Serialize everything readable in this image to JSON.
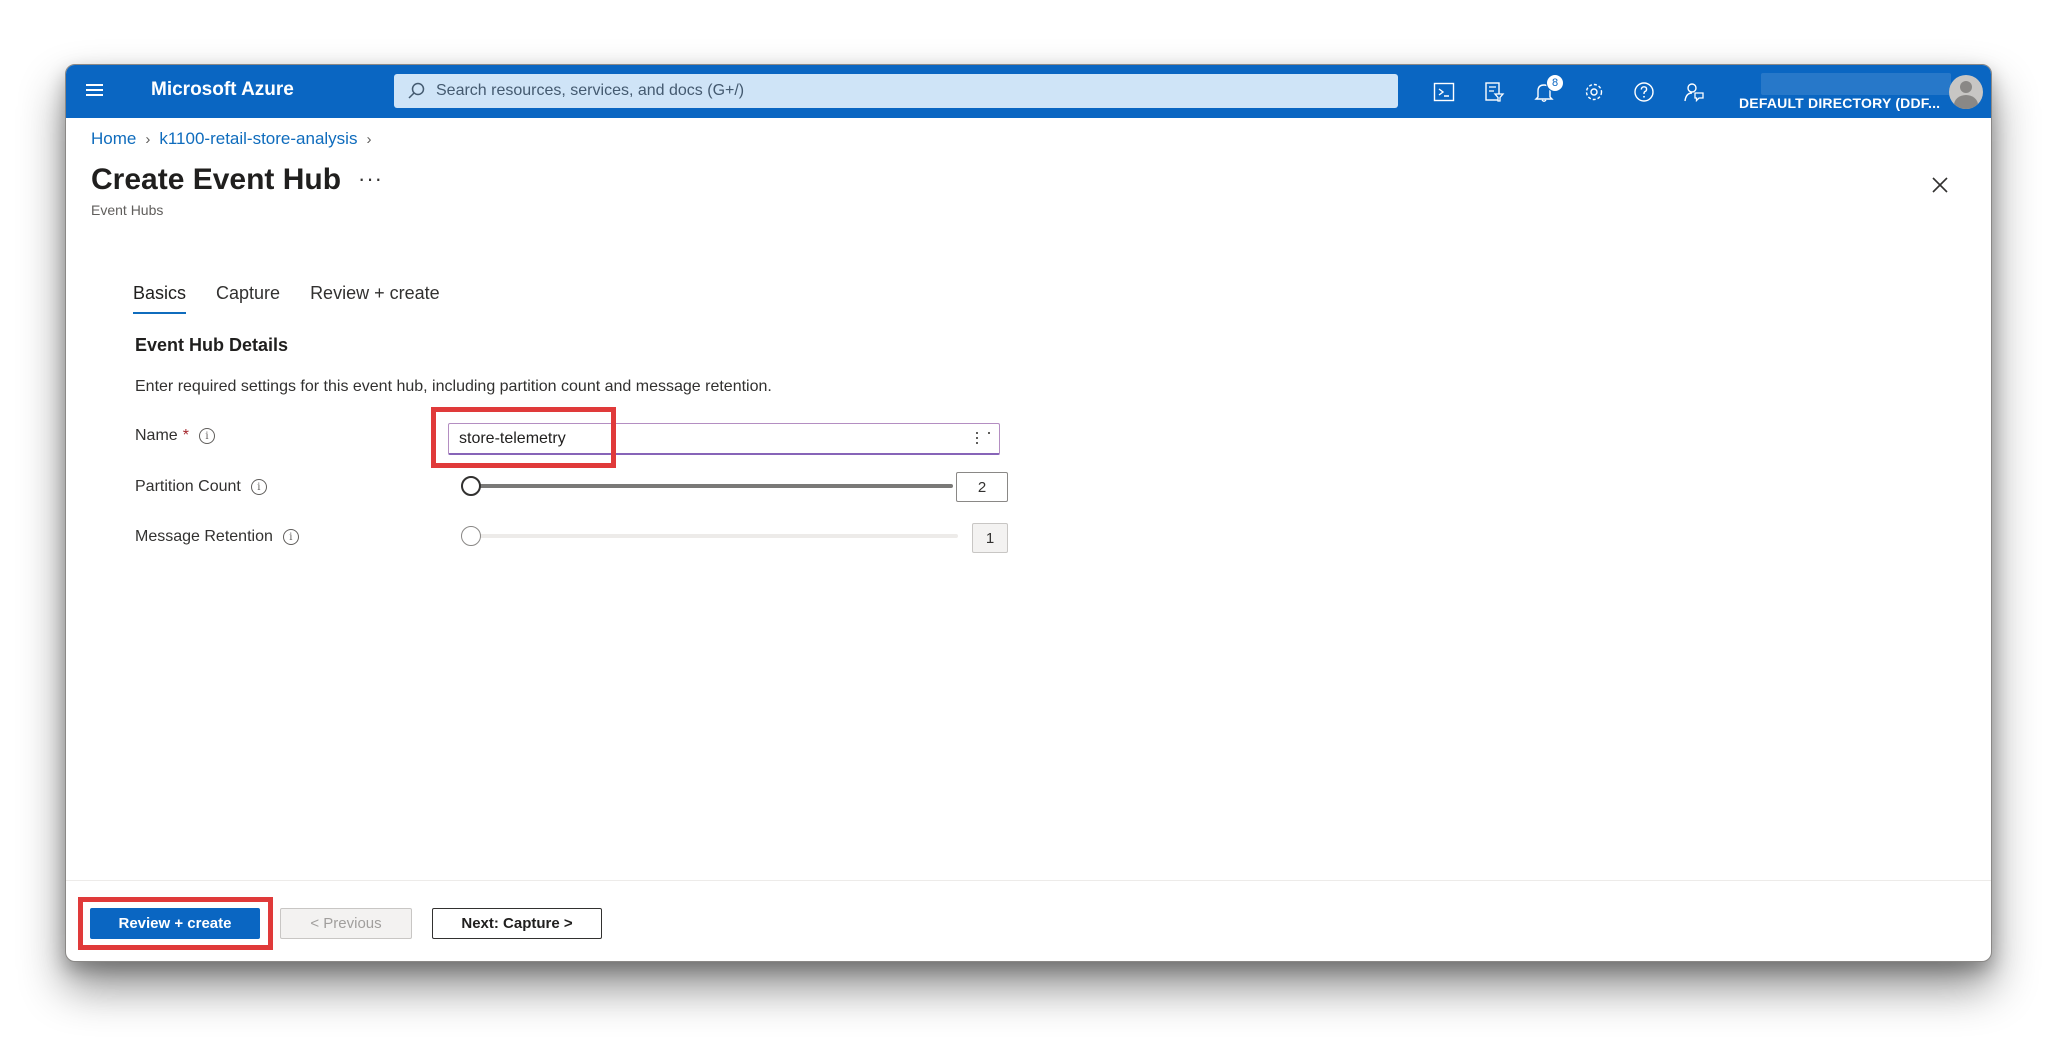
{
  "topbar": {
    "brand": "Microsoft Azure",
    "search_placeholder": "Search resources, services, and docs (G+/)",
    "notification_count": "8",
    "directory": "DEFAULT DIRECTORY (DDF...",
    "icons": [
      "cloud-shell-icon",
      "directory-filter-icon",
      "bell-icon",
      "gear-icon",
      "help-icon",
      "feedback-icon"
    ],
    "color": "#0a66c2"
  },
  "breadcrumb": {
    "items": [
      "Home",
      "k1100-retail-store-analysis"
    ]
  },
  "page": {
    "title": "Create Event Hub",
    "more": "···",
    "subtitle": "Event Hubs"
  },
  "tabs": [
    "Basics",
    "Capture",
    "Review + create"
  ],
  "form": {
    "section_title": "Event Hub Details",
    "description": "Enter required settings for this event hub, including partition count and message retention.",
    "name_label": "Name",
    "required_marker": "*",
    "name_value": "store-telemetry",
    "partition_label": "Partition Count",
    "partition_value": "2",
    "partition_fraction": 0,
    "retention_label": "Message Retention",
    "retention_value": "1",
    "retention_fraction": 0,
    "info_glyph": "i"
  },
  "footer": {
    "review_create": "Review + create",
    "previous": "< Previous",
    "next": "Next: Capture >"
  },
  "highlight_color": "#e03a3a"
}
